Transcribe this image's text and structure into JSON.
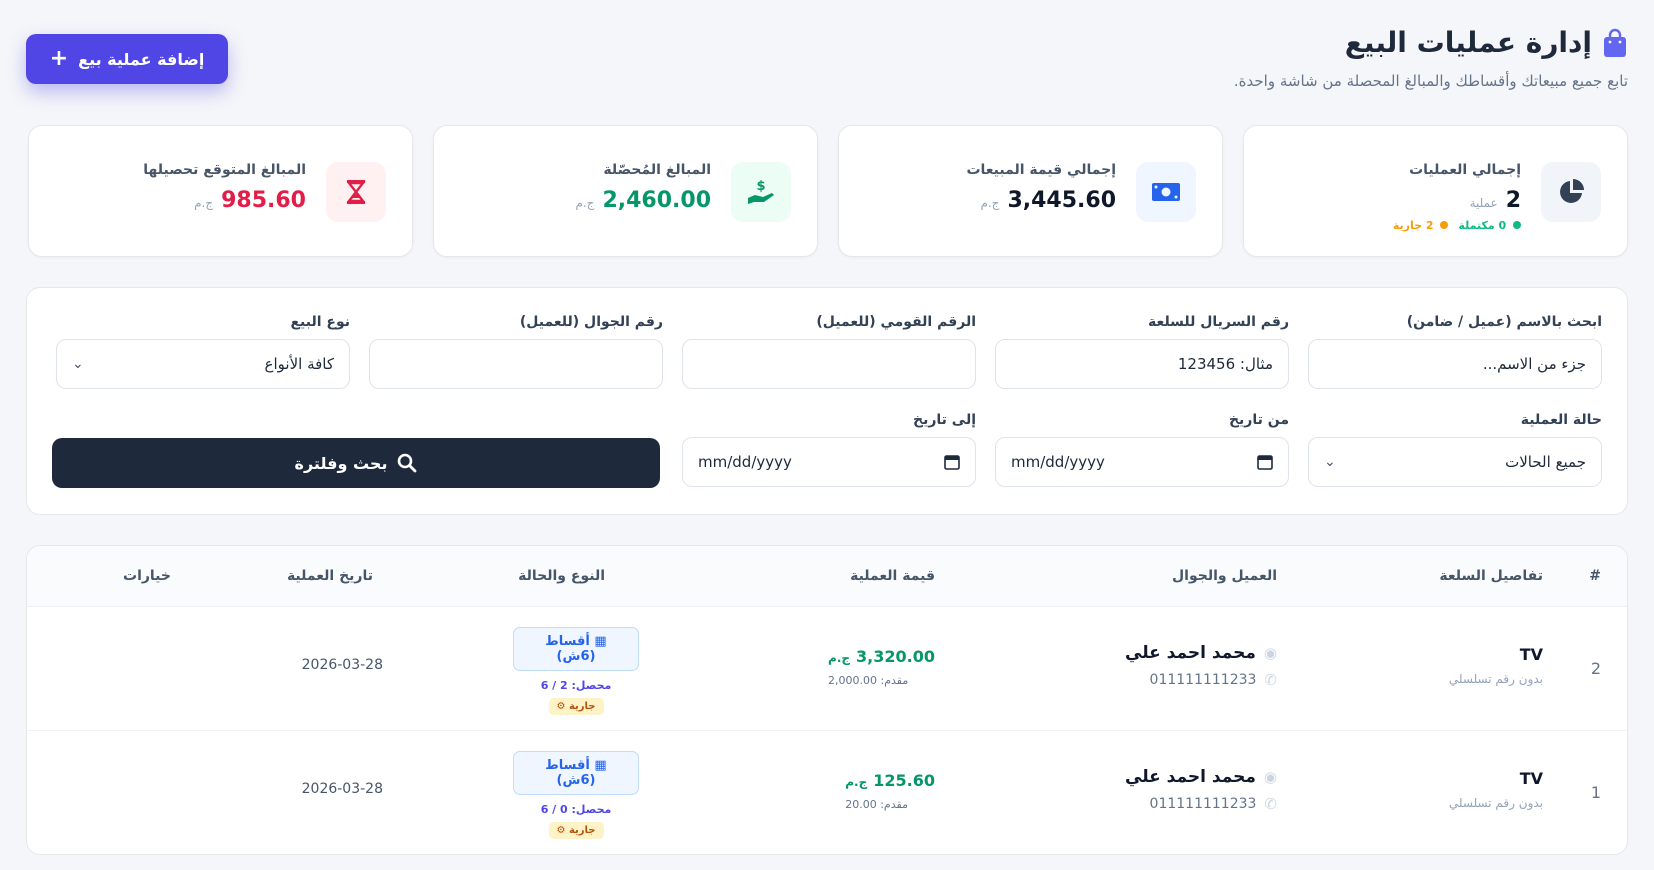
{
  "header": {
    "title": "إدارة عمليات البيع",
    "subtitle": "تابع جميع مبيعاتك وأقساطك والمبالغ المحصلة من شاشة واحدة.",
    "add_button_label": "إضافة عملية بيع"
  },
  "stats": [
    {
      "label": "إجمالي العمليات",
      "value": "2",
      "unit": "عملية",
      "sub": [
        {
          "count": "0",
          "label": "مكتملة",
          "color": "#10b981"
        },
        {
          "count": "2",
          "label": "جارية",
          "color": "#f59e0b"
        }
      ],
      "icon": "pie-chart-icon",
      "icon_color": "#334155",
      "icon_bg": "#f1f5f9"
    },
    {
      "label": "إجمالي قيمة المبيعات",
      "value": "3,445.60",
      "unit": "ج.م",
      "icon": "money-bill-icon",
      "icon_color": "#2563eb",
      "icon_bg": "#eff6ff"
    },
    {
      "label": "المبالغ المُحصّلة",
      "value": "2,460.00",
      "unit": "ج.م",
      "icon": "hand-dollar-icon",
      "icon_color": "#059669",
      "icon_bg": "#ecfdf5"
    },
    {
      "label": "المبالغ المتوقع تحصيلها",
      "value": "985.60",
      "unit": "ج.م",
      "icon": "hourglass-icon",
      "icon_color": "#e11d48",
      "icon_bg": "#fff1f2"
    }
  ],
  "filters": {
    "name": {
      "label": "ابحث بالاسم (عميل / ضامن)",
      "placeholder": "جزء من الاسم..."
    },
    "serial": {
      "label": "رقم السريال للسلعة",
      "placeholder": "مثال: 123456"
    },
    "national_id": {
      "label": "الرقم القومي (للعميل)",
      "placeholder": ""
    },
    "phone": {
      "label": "رقم الجوال (للعميل)",
      "placeholder": ""
    },
    "sale_type": {
      "label": "نوع البيع",
      "value": "كافة الأنواع"
    },
    "status": {
      "label": "حالة العملية",
      "value": "جميع الحالات"
    },
    "from_date": {
      "label": "من تاريخ",
      "value": "mm/dd/yyyy"
    },
    "to_date": {
      "label": "إلى تاريخ",
      "value": "mm/dd/yyyy"
    },
    "search_button_label": "بحث وفلترة"
  },
  "table": {
    "columns": [
      "#",
      "تفاصيل السلعة",
      "العميل والجوال",
      "قيمة العملية",
      "النوع والحالة",
      "تاريخ العملية",
      "خيارات"
    ],
    "rows": [
      {
        "idx": "2",
        "item": "TV",
        "serial": "بدون رقم تسلسلي",
        "customer": "محمد احمد علي",
        "phone": "011111111233",
        "amount": "3,320.00",
        "unit": "ج.م",
        "deposit": "مقدم: 2,000.00",
        "type": "أقساط (6ش)",
        "collected": "محصل: 2 / 6",
        "status": "جارية",
        "date": "2026-03-28"
      },
      {
        "idx": "1",
        "item": "TV",
        "serial": "بدون رقم تسلسلي",
        "customer": "محمد احمد علي",
        "phone": "011111111233",
        "amount": "125.60",
        "unit": "ج.م",
        "deposit": "مقدم: 20.00",
        "type": "أقساط (6ش)",
        "collected": "محصل: 0 / 6",
        "status": "جارية",
        "date": "2026-03-28"
      }
    ]
  }
}
